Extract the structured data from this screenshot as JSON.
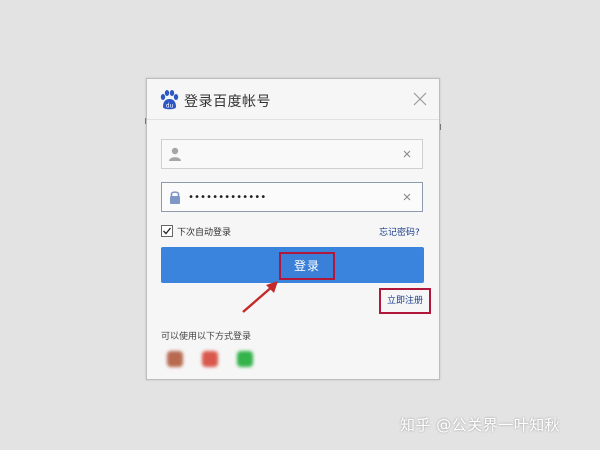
{
  "dialog": {
    "title": "登录百度帐号",
    "logo_icon": "baidu-paw-icon",
    "close_icon": "close-icon"
  },
  "form": {
    "username": {
      "value": "",
      "icon": "user-icon",
      "clear_icon": "clear-x-icon"
    },
    "password": {
      "value": "•••••••••••••",
      "icon": "lock-icon",
      "clear_icon": "clear-x-icon"
    },
    "remember": {
      "label": "下次自动登录",
      "checked": true
    },
    "forgot_label": "忘记密码?",
    "login_label": "登录",
    "register_label": "立即注册"
  },
  "other_login": {
    "label": "可以使用以下方式登录",
    "providers": [
      "social-icon-1",
      "social-icon-2",
      "social-icon-3"
    ]
  },
  "watermark": "知乎 @公关界一叶知秋",
  "colors": {
    "accent_blue": "#3a84de",
    "highlight_red": "#b0173a",
    "link_blue": "#1a3d88"
  }
}
